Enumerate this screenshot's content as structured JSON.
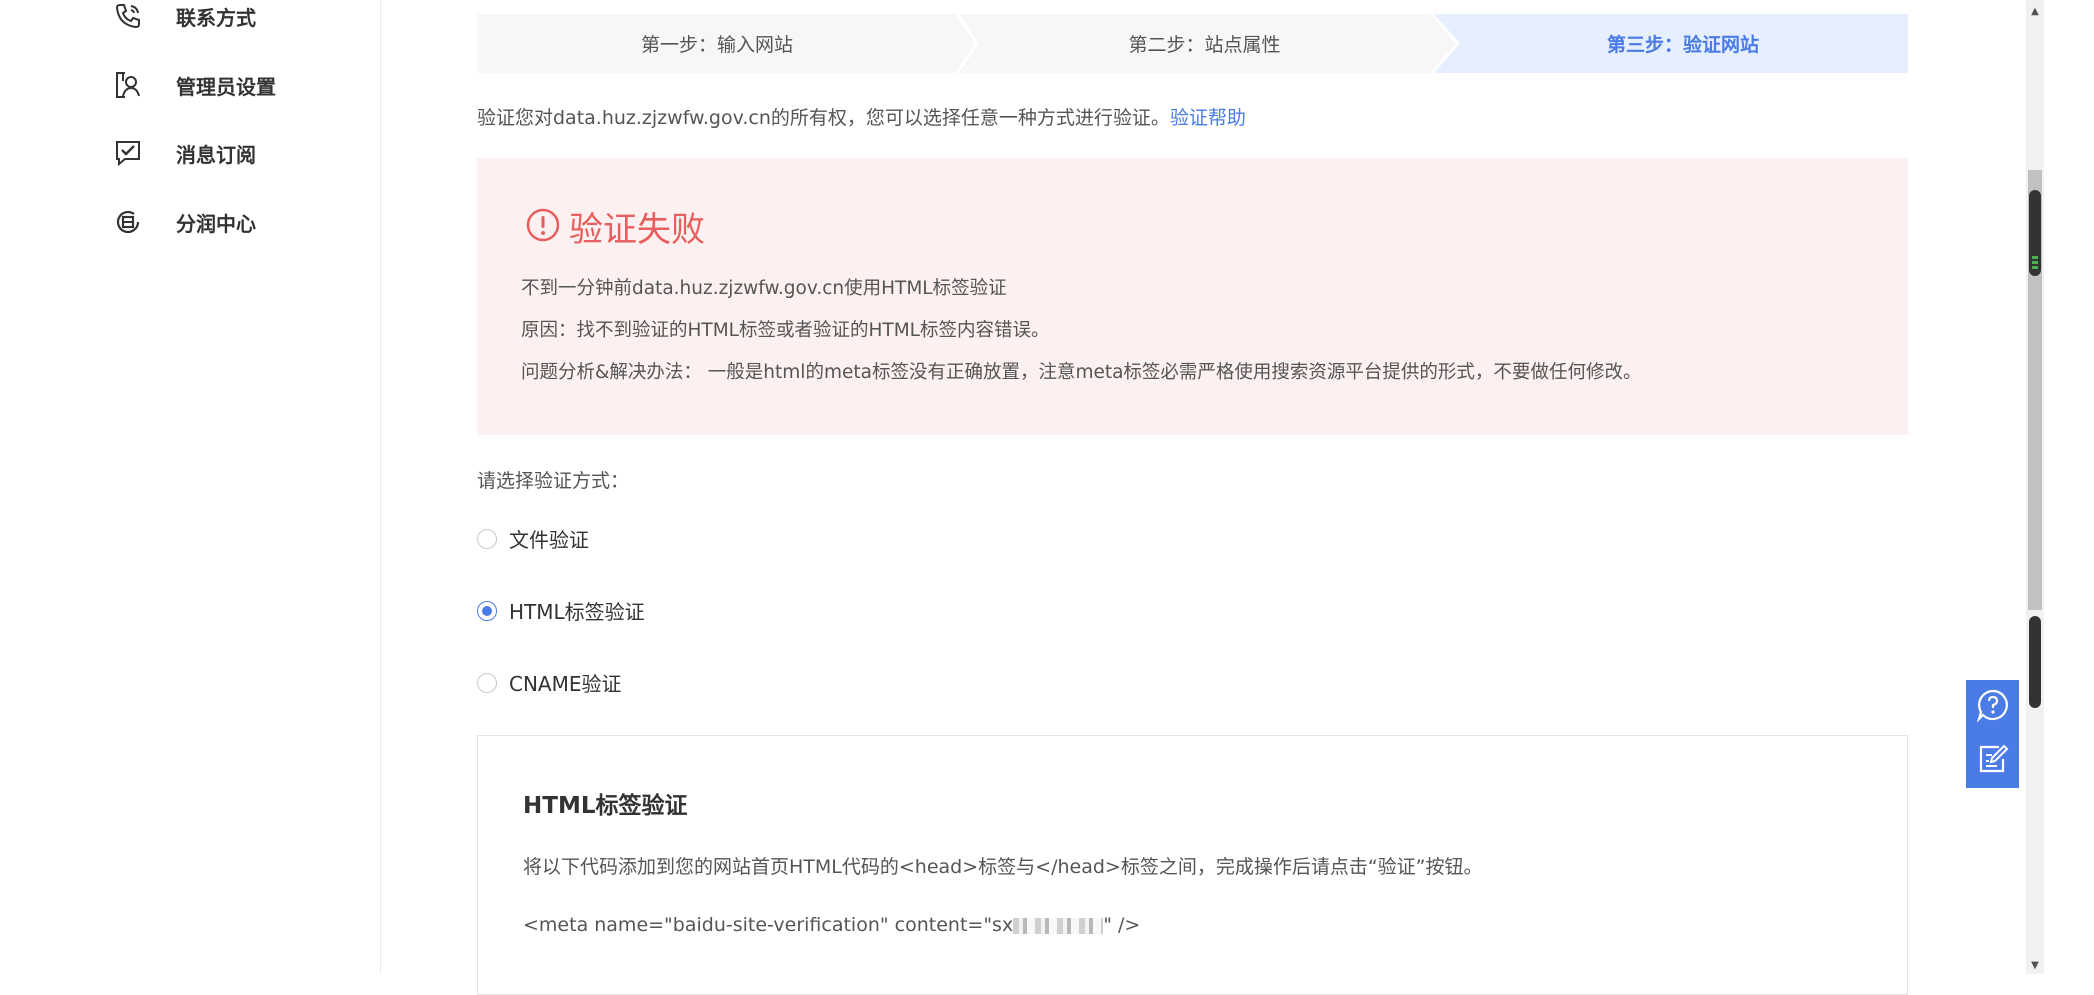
{
  "sidebar": {
    "items": [
      {
        "label": "联系方式",
        "icon": "phone-icon"
      },
      {
        "label": "管理员设置",
        "icon": "admin-user-icon"
      },
      {
        "label": "消息订阅",
        "icon": "message-check-icon"
      },
      {
        "label": "分润中心",
        "icon": "revenue-share-icon"
      }
    ]
  },
  "steps": [
    {
      "label": "第一步：输入网站",
      "active": false
    },
    {
      "label": "第二步：站点属性",
      "active": false
    },
    {
      "label": "第三步：验证网站",
      "active": true
    }
  ],
  "intro": {
    "text": "验证您对data.huz.zjzwfw.gov.cn的所有权，您可以选择任意一种方式进行验证。",
    "help_link": "验证帮助"
  },
  "error": {
    "title": "验证失败",
    "icon": "alert-circle-icon",
    "lines": [
      "不到一分钟前data.huz.zjzwfw.gov.cn使用HTML标签验证",
      "原因：找不到验证的HTML标签或者验证的HTML标签内容错误。",
      "问题分析&解决办法：  一般是html的meta标签没有正确放置，注意meta标签必需严格使用搜索资源平台提供的形式，不要做任何修改。"
    ]
  },
  "methods": {
    "label": "请选择验证方式：",
    "options": [
      {
        "label": "文件验证",
        "selected": false
      },
      {
        "label": "HTML标签验证",
        "selected": true
      },
      {
        "label": "CNAME验证",
        "selected": false
      }
    ]
  },
  "panel": {
    "title": "HTML标签验证",
    "description": "将以下代码添加到您的网站首页HTML代码的<head>标签与</head>标签之间，完成操作后请点击“验证”按钮。",
    "code_prefix": "<meta name=\"baidu-site-verification\" content=\"sx",
    "code_suffix": "\" />"
  },
  "float_tools": {
    "help_icon": "help-chat-icon",
    "feedback_icon": "feedback-edit-icon"
  },
  "colors": {
    "accent": "#4b7be5",
    "error": "#e85d5d",
    "error_bg": "#fdf0f1",
    "step_bg": "#f7f7f7",
    "active_step_bg": "#e6efff"
  }
}
